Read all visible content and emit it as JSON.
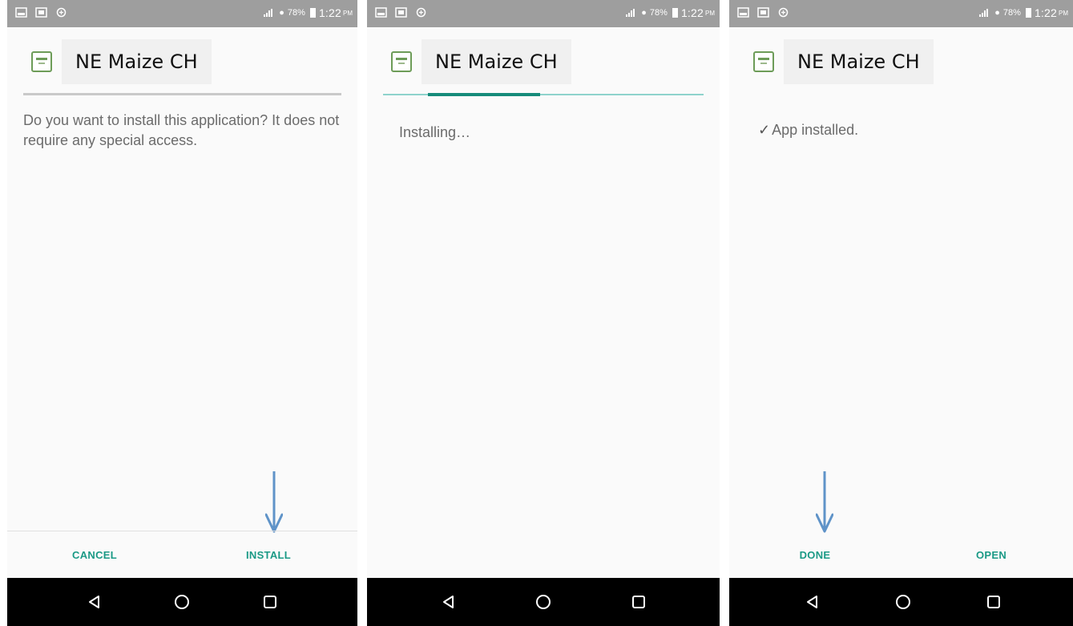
{
  "colors": {
    "status_bar": "#9e9e9e",
    "accent_teal": "#1a9a86",
    "progress_fill": "#168b7a",
    "progress_track": "#8fd3cc",
    "arrow_blue": "#5f93c8",
    "nav_bar": "#000000"
  },
  "status_bar": {
    "battery_percent": "78%",
    "time": "1:22",
    "ampm": "PM",
    "left_icons": [
      "image-icon",
      "notification-icon",
      "sync-icon"
    ]
  },
  "screens": [
    {
      "app_name": "NE Maize CH",
      "message": "Do you want to install this application? It does not require any special access.",
      "buttons": [
        "CANCEL",
        "INSTALL"
      ],
      "arrow_target": "INSTALL"
    },
    {
      "app_name": "NE Maize CH",
      "message": "Installing…",
      "progress_fraction": 0.35,
      "progress_offset_fraction": 0.14
    },
    {
      "app_name": "NE Maize CH",
      "message": "App installed.",
      "buttons": [
        "DONE",
        "OPEN"
      ],
      "arrow_target": "DONE"
    }
  ],
  "nav_bar": {
    "icons": [
      "back-icon",
      "home-icon",
      "recents-icon"
    ]
  }
}
